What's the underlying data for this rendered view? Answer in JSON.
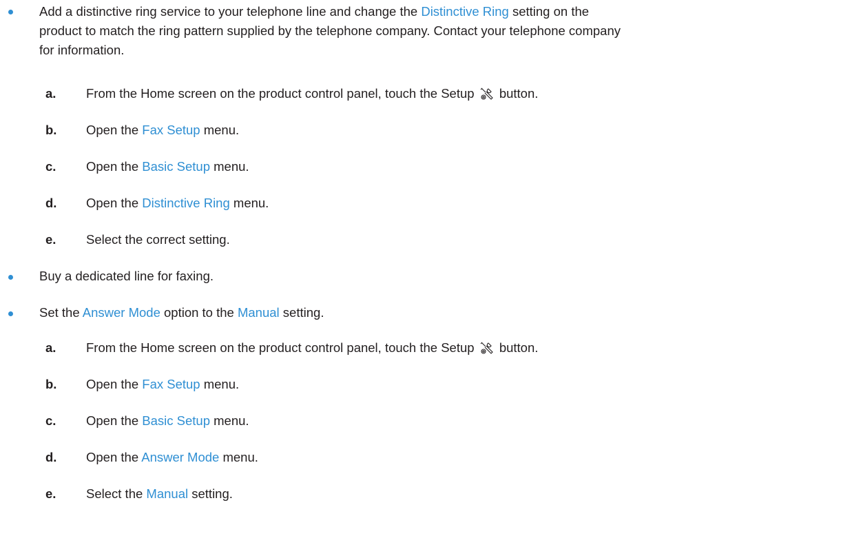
{
  "colors": {
    "text": "#231f20",
    "accent": "#2f8fd3"
  },
  "bullet1": {
    "text_pre": "Add a distinctive ring service to your telephone line and change the ",
    "ui_term": "Distinctive Ring",
    "line1_post": " setting on the",
    "line2": "product to match the ring pattern supplied by the telephone company. Contact your telephone company",
    "line3": "for information.",
    "steps": [
      {
        "letter": "a.",
        "pre": "From the Home screen on the product control panel, touch the Setup",
        "icon": "setup-tools-icon",
        "post": "button."
      },
      {
        "letter": "b.",
        "pre": "Open the ",
        "ui": "Fax Setup",
        "post": " menu."
      },
      {
        "letter": "c.",
        "pre": "Open the ",
        "ui": "Basic Setup",
        "post": " menu."
      },
      {
        "letter": "d.",
        "pre": "Open the ",
        "ui": "Distinctive Ring",
        "post": " menu."
      },
      {
        "letter": "e.",
        "pre": "Select the correct setting."
      }
    ]
  },
  "bullet2": {
    "text": "Buy a dedicated line for faxing."
  },
  "bullet3": {
    "pre": "Set the ",
    "ui1": "Answer Mode",
    "mid": " option to the ",
    "ui2": "Manual",
    "post": " setting.",
    "steps": [
      {
        "letter": "a.",
        "pre": "From the Home screen on the product control panel, touch the Setup",
        "icon": "setup-tools-icon",
        "post": "button."
      },
      {
        "letter": "b.",
        "pre": "Open the ",
        "ui": "Fax Setup",
        "post": " menu."
      },
      {
        "letter": "c.",
        "pre": "Open the ",
        "ui": "Basic Setup",
        "post": " menu."
      },
      {
        "letter": "d.",
        "pre": "Open the ",
        "ui": "Answer Mode",
        "post": " menu."
      },
      {
        "letter": "e.",
        "pre": "Select the ",
        "ui": "Manual",
        "post": " setting."
      }
    ]
  }
}
